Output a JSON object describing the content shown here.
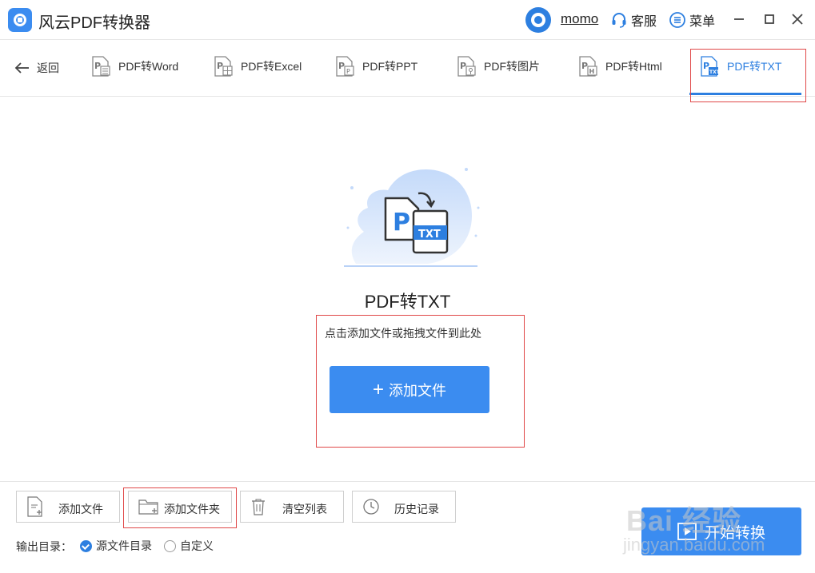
{
  "app": {
    "title": "风云PDF转换器"
  },
  "header": {
    "username": "momo",
    "service_label": "客服",
    "menu_label": "菜单"
  },
  "nav": {
    "back_label": "返回",
    "tabs": [
      {
        "label": "PDF转Word",
        "icon": "pdf-word-icon",
        "glyph": "W"
      },
      {
        "label": "PDF转Excel",
        "icon": "pdf-excel-icon",
        "glyph": "X"
      },
      {
        "label": "PDF转PPT",
        "icon": "pdf-ppt-icon",
        "glyph": "P"
      },
      {
        "label": "PDF转图片",
        "icon": "pdf-image-icon",
        "glyph": "I"
      },
      {
        "label": "PDF转Html",
        "icon": "pdf-html-icon",
        "glyph": "H"
      },
      {
        "label": "PDF转TXT",
        "icon": "pdf-txt-icon",
        "glyph": "T",
        "active": true
      }
    ]
  },
  "main": {
    "title": "PDF转TXT",
    "illustration_badge": "TXT",
    "illustration_letter": "P",
    "hint": "点击添加文件或拖拽文件到此处",
    "add_button": "添加文件"
  },
  "toolbar": {
    "add_file": "添加文件",
    "add_folder": "添加文件夹",
    "clear_list": "清空列表",
    "history": "历史记录"
  },
  "output": {
    "label": "输出目录：",
    "options": [
      {
        "label": "源文件目录",
        "selected": true
      },
      {
        "label": "自定义",
        "selected": false
      }
    ]
  },
  "start_button": "开始转换",
  "watermark": {
    "text": "Bai 经验",
    "url": "jingyan.baidu.com"
  },
  "colors": {
    "accent": "#3b8cf0",
    "active_tab": "#2d7fe0",
    "highlight_box": "#e04848"
  }
}
